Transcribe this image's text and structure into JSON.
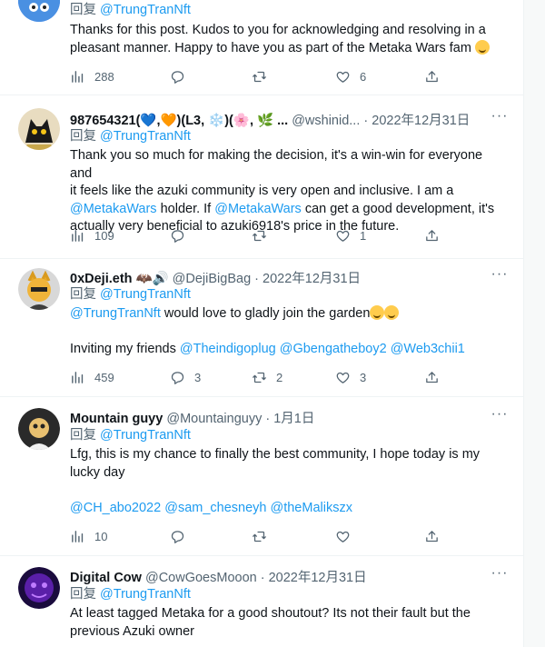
{
  "reply_prefix": "回复",
  "tweets": [
    {
      "reply_to": "@TrungTranNft",
      "lines": [
        "Thanks for this post. Kudos to you for acknowledging and resolving in a",
        "pleasant manner. Happy to have you as part of the Metaka Wars fam"
      ],
      "views": "288",
      "replies": "",
      "retweets": "",
      "likes": "6"
    },
    {
      "name": "987654321(💙,🧡)(L3, ❄️)(🌸, 🌿 ...",
      "handle": "@wshinid...",
      "date": "· 2022年12月31日",
      "reply_to": "@TrungTranNft",
      "lines": [
        "Thank you so much for making the decision, it's a win-win for everyone and",
        "it feels like the azuki community is very open and inclusive. I am a",
        "actually very beneficial to azuki6918's price in the future."
      ],
      "line3_parts": [
        "@MetakaWars",
        " holder. If ",
        "@MetakaWars",
        " can get a good development, it's"
      ],
      "views": "109",
      "replies": "",
      "retweets": "",
      "likes": "1"
    },
    {
      "name": "0xDeji.eth",
      "handle": "@DejiBigBag",
      "date": "· 2022年12月31日",
      "reply_to": "@TrungTranNft",
      "mention": "@TrungTranNft",
      "line1_rest": " would love to gladly join the garden",
      "line2_prefix": "Inviting my friends ",
      "mentions": [
        "@Theindigoplug",
        "@Gbengatheboy2",
        "@Web3chii1"
      ],
      "views": "459",
      "replies": "3",
      "retweets": "2",
      "likes": "3"
    },
    {
      "name": "Mountain guyy",
      "handle": "@Mountainguyy",
      "date": "· 1月1日",
      "reply_to": "@TrungTranNft",
      "lines": [
        "Lfg, this is my chance to finally the best community, I hope today is my",
        "lucky day"
      ],
      "mentions": [
        "@CH_abo2022",
        "@sam_chesneyh",
        "@theMalikszx"
      ],
      "views": "10",
      "replies": "",
      "retweets": "",
      "likes": ""
    },
    {
      "name": "Digital Cow",
      "handle": "@CowGoesMooon",
      "date": "· 2022年12月31日",
      "reply_to": "@TrungTranNft",
      "lines": [
        "At least tagged Metaka for a good shoutout? Its not their fault but the",
        "previous Azuki owner"
      ]
    }
  ],
  "colors": {
    "link": "#1d9bf0",
    "muted": "#536471",
    "text": "#0f1419",
    "divider": "#eff3f4"
  },
  "icons": [
    "views-icon",
    "reply-icon",
    "retweet-icon",
    "like-icon",
    "share-icon",
    "more-icon"
  ]
}
